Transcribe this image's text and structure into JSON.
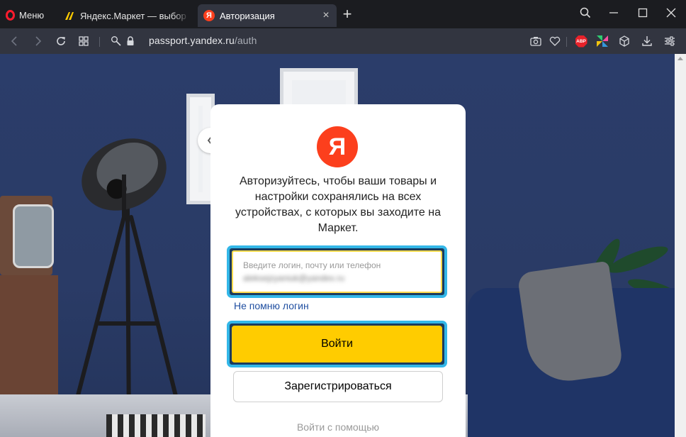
{
  "browser": {
    "menu_label": "Меню",
    "tabs": [
      {
        "title": "Яндекс.Маркет — выбор и",
        "favicon": "yandex-market-icon",
        "active": false
      },
      {
        "title": "Авторизация",
        "favicon": "yandex-ya-icon",
        "active": true
      }
    ],
    "tab_close_glyph": "×",
    "new_tab_glyph": "+",
    "url_host": "passport.yandex.ru",
    "url_path": "/auth",
    "adblock_label": "ABP"
  },
  "auth": {
    "logo_letter": "Я",
    "description": "Авторизуйтесь, чтобы ваши товары и настройки сохранялись на всех устройствах, с которых вы заходите на Маркет.",
    "login_placeholder": "Введите логин, почту или телефон",
    "login_value": "aleksejzyaniuk@yandex.ru",
    "forgot_link": "Не помню логин",
    "login_button": "Войти",
    "register_button": "Зарегистрироваться",
    "alt_login": "Войти с помощью"
  },
  "colors": {
    "yandex_red": "#fc3f1d",
    "login_yellow": "#ffcc00",
    "highlight_blue": "#33b7e8",
    "link_blue": "#1f4ea0"
  }
}
